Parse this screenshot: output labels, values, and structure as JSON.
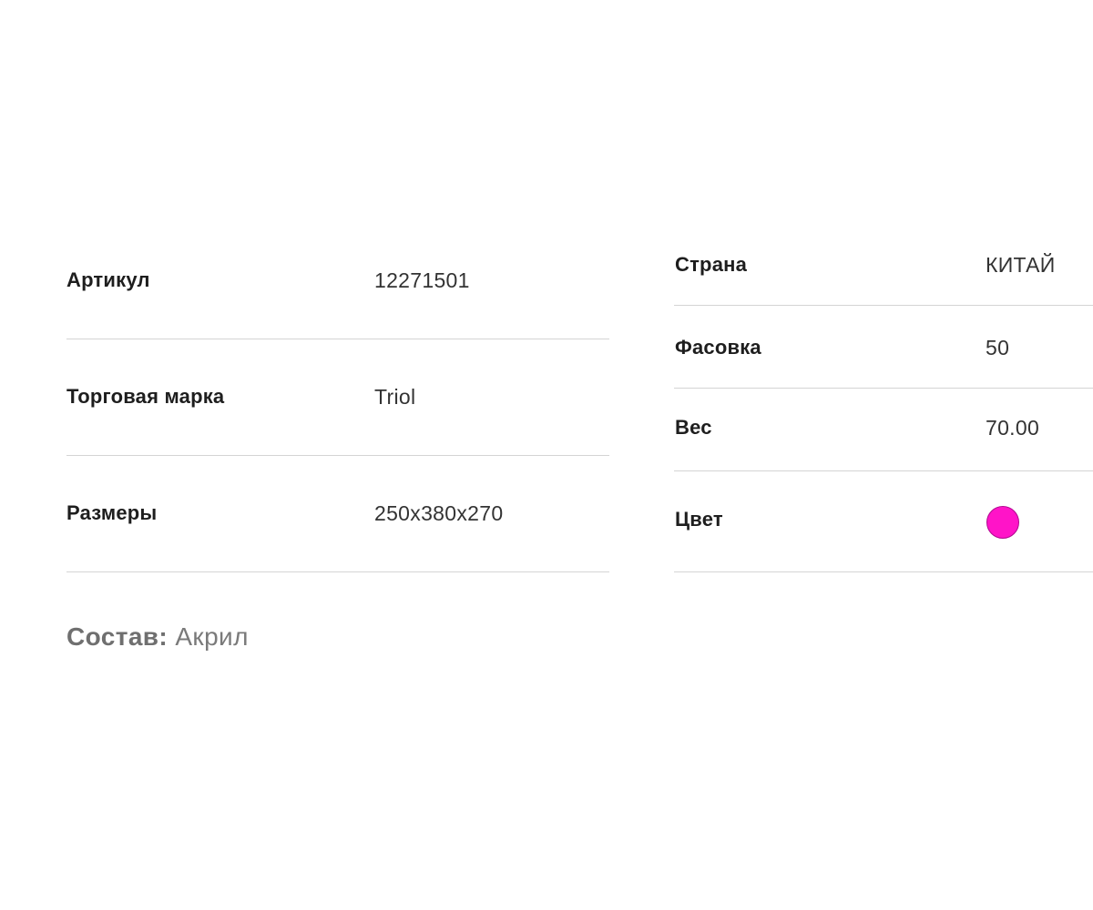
{
  "specs": {
    "left": [
      {
        "label": "Артикул",
        "value": "12271501"
      },
      {
        "label": "Торговая марка",
        "value": "Triol"
      },
      {
        "label": "Размеры",
        "value": "250x380x270"
      }
    ],
    "right": [
      {
        "label": "Страна",
        "value": "КИТАЙ"
      },
      {
        "label": "Фасовка",
        "value": "50"
      },
      {
        "label": "Вес",
        "value": "70.00"
      },
      {
        "label": "Цвет",
        "color": "#ff14c8"
      }
    ]
  },
  "composition": {
    "label": "Состав:",
    "value": "Акрил"
  }
}
